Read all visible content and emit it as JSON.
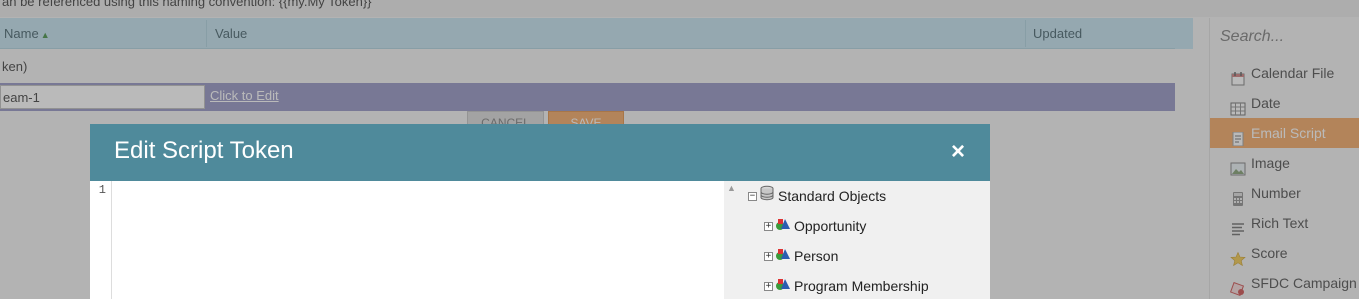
{
  "background": {
    "top_strip_text": "an be referenced using this naming convention: {{my.My Token}}",
    "grid": {
      "columns": [
        {
          "label": "Name"
        },
        {
          "label": "Value"
        },
        {
          "label": "Updated"
        }
      ],
      "row1_text": "ken)",
      "row2": {
        "name_value": "eam-1",
        "click_to_edit": "Click to Edit"
      }
    },
    "buttons": {
      "cancel": "CANCEL",
      "save": "SAVE"
    }
  },
  "sidebar": {
    "search_placeholder": "Search...",
    "items": [
      {
        "label": "Calendar File",
        "icon": "calendar-icon"
      },
      {
        "label": "Date",
        "icon": "date-grid-icon"
      },
      {
        "label": "Email Script",
        "icon": "script-icon",
        "active": true
      },
      {
        "label": "Image",
        "icon": "image-icon"
      },
      {
        "label": "Number",
        "icon": "number-icon"
      },
      {
        "label": "Rich Text",
        "icon": "rich-text-icon"
      },
      {
        "label": "Score",
        "icon": "star-icon"
      },
      {
        "label": "SFDC Campaign",
        "icon": "sfdc-campaign-icon"
      }
    ]
  },
  "dialog": {
    "title": "Edit Script Token",
    "close_symbol": "×",
    "editor": {
      "line_numbers": [
        "1"
      ],
      "content": ""
    },
    "tree": {
      "root": {
        "label": "Standard Objects",
        "icon": "database-icon"
      },
      "children": [
        {
          "label": "Opportunity",
          "icon": "object-shapes-icon"
        },
        {
          "label": "Person",
          "icon": "object-shapes-icon"
        },
        {
          "label": "Program Membership",
          "icon": "object-shapes-icon"
        }
      ]
    }
  },
  "colors": {
    "dialog_header": "#4f8a9b",
    "active_item": "#f3a35a",
    "grid_header": "#bfe1ee",
    "selected_row": "#8e8ec0"
  }
}
